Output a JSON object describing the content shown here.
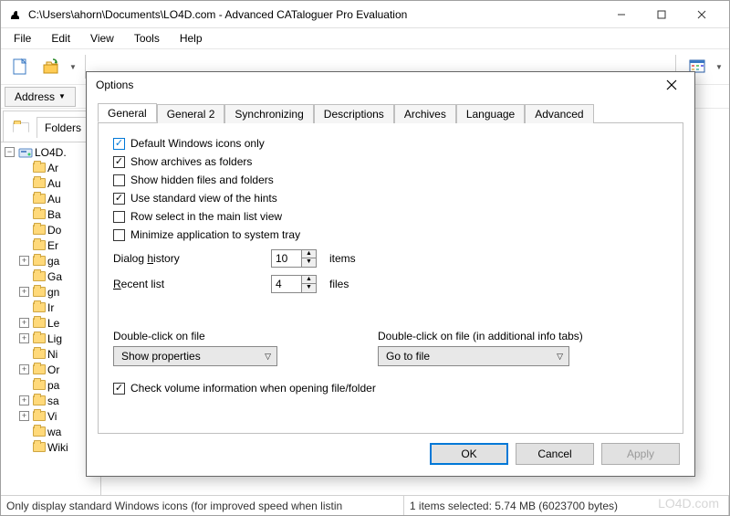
{
  "window": {
    "title": "C:\\Users\\ahorn\\Documents\\LO4D.com - Advanced CATaloguer Pro Evaluation"
  },
  "menu": {
    "file": "File",
    "edit": "Edit",
    "view": "View",
    "tools": "Tools",
    "help": "Help"
  },
  "address_label": "Address",
  "folders_tab": "Folders",
  "tree": {
    "root": "LO4D.",
    "items": [
      "Ar",
      "Au",
      "Au",
      "Ba",
      "Do",
      "Er",
      "ga",
      "Ga",
      "gn",
      "Ir",
      "Le",
      "Lig",
      "Ni",
      "Or",
      "pa",
      "sa",
      "Vi",
      "wa",
      "Wiki"
    ]
  },
  "status": {
    "left": "Only display standard Windows icons  (for improved speed when listin",
    "right": "1 items selected: 5.74 MB (6023700 bytes)"
  },
  "watermark": "LO4D.com",
  "dialog": {
    "title": "Options",
    "tabs": [
      "General",
      "General 2",
      "Synchronizing",
      "Descriptions",
      "Archives",
      "Language",
      "Advanced"
    ],
    "checks": {
      "default_icons": "Default Windows icons only",
      "show_archives": "Show archives as folders",
      "show_hidden": "Show hidden files and folders",
      "std_hints": "Use standard view of the hints",
      "row_select": "Row select in the main list view",
      "minimize_tray": "Minimize application to system tray",
      "check_volume": "Check volume information when opening file/folder"
    },
    "checked": {
      "default_icons": true,
      "show_archives": true,
      "show_hidden": false,
      "std_hints": true,
      "row_select": false,
      "minimize_tray": false,
      "check_volume": true
    },
    "dialog_history_label": "Dialog history",
    "dialog_history_value": "10",
    "dialog_history_unit": "items",
    "recent_list_label": "Recent list",
    "recent_list_value": "4",
    "recent_list_unit": "files",
    "dbl_file_label": "Double-click on file",
    "dbl_file_value": "Show properties",
    "dbl_file_tabs_label": "Double-click on file (in additional info tabs)",
    "dbl_file_tabs_value": "Go to file",
    "ok": "OK",
    "cancel": "Cancel",
    "apply": "Apply"
  }
}
